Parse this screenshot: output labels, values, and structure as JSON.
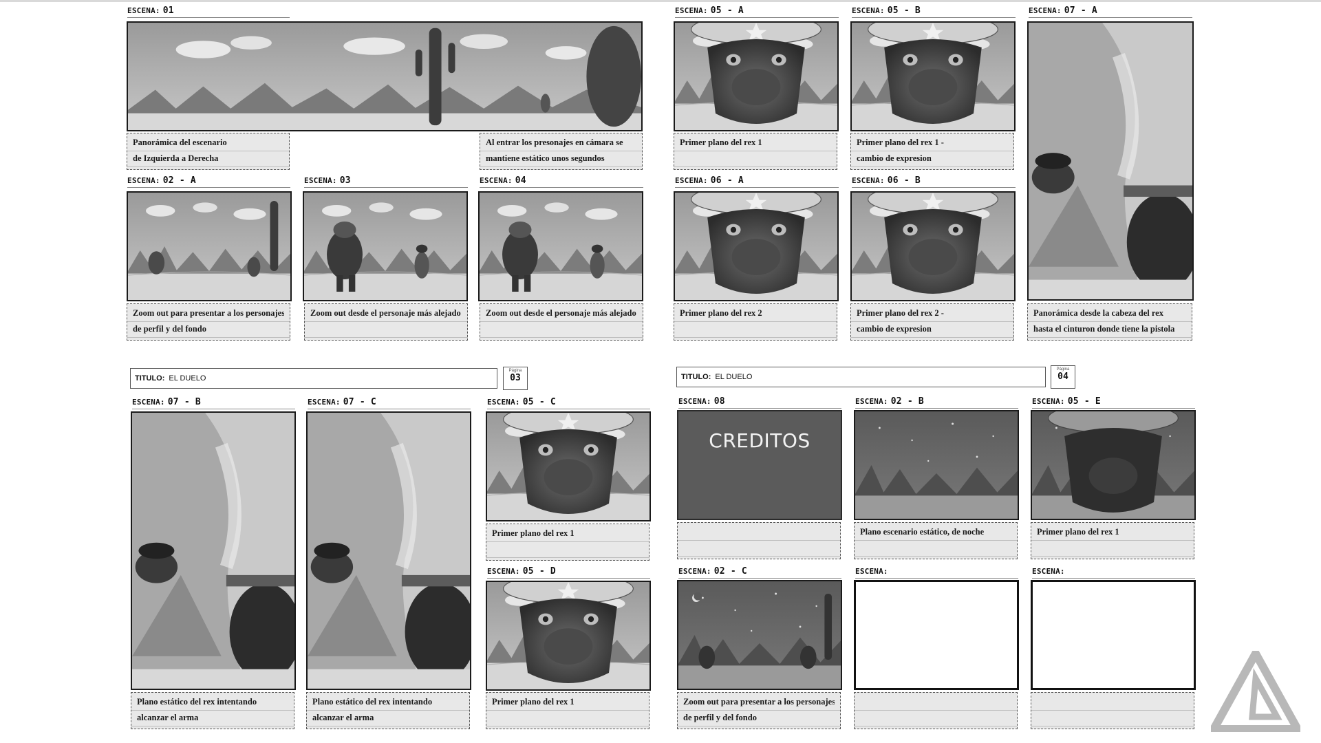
{
  "label_prefix": "ESCENA:",
  "pages": [
    {
      "title_label": "TITULO:",
      "title_value": "EL DUELO",
      "page_label": "Página",
      "page_number": "03",
      "scenes": {
        "s01": {
          "label": "01"
        },
        "s02a": {
          "label": "02 - A"
        },
        "s03": {
          "label": "03"
        },
        "s04": {
          "label": "04"
        },
        "s07b": {
          "label": "07 - B"
        },
        "s07c": {
          "label": "07 - C"
        },
        "s05c": {
          "label": "05 - C"
        },
        "s05d": {
          "label": "05 - D"
        }
      },
      "notes": {
        "s01_left": [
          "Panorámica del escenario",
          "de Izquierda a Derecha"
        ],
        "s01_right": [
          "Al entrar los presonajes en cámara se",
          "mantiene estático unos segundos"
        ],
        "s02a": [
          "Zoom out para presentar a los personajes",
          "de perfil y del fondo"
        ],
        "s03": [
          "Zoom out desde el personaje más alejado",
          ""
        ],
        "s04": [
          "Zoom out desde el personaje más alejado",
          ""
        ],
        "s07b": [
          "Plano estático del rex intentando",
          "alcanzar el arma"
        ],
        "s07c": [
          "Plano estático del rex intentando",
          "alcanzar el arma"
        ],
        "s05c": [
          "Primer plano del rex 1",
          ""
        ],
        "s05d": [
          "Primer plano del rex 1",
          ""
        ]
      }
    },
    {
      "title_label": "TITULO:",
      "title_value": "EL DUELO",
      "page_label": "Página",
      "page_number": "04",
      "scenes": {
        "s05a": {
          "label": "05 - A"
        },
        "s05b": {
          "label": "05 - B"
        },
        "s07a": {
          "label": "07 - A"
        },
        "s06a": {
          "label": "06 - A"
        },
        "s06b": {
          "label": "06 - B"
        },
        "s08": {
          "label": "08"
        },
        "s02b": {
          "label": "02 - B"
        },
        "s05e": {
          "label": "05 - E"
        },
        "s02c": {
          "label": "02 - C"
        },
        "sx1": {
          "label": ""
        },
        "sx2": {
          "label": ""
        }
      },
      "credits_text": "CREDITOS",
      "notes": {
        "s05a": [
          "Primer plano del rex 1",
          ""
        ],
        "s05b": [
          "Primer plano del rex 1 -",
          "cambio de expresion"
        ],
        "s07a": [
          "Panorámica desde la cabeza del rex",
          "hasta el cinturon donde tiene la pistola"
        ],
        "s06a": [
          "Primer plano del rex 2",
          ""
        ],
        "s06b": [
          "Primer plano del rex 2 -",
          "cambio de expresion"
        ],
        "s08": [
          "",
          ""
        ],
        "s02b": [
          "Plano escenario estático, de noche",
          ""
        ],
        "s05e": [
          "Primer plano del rex 1",
          ""
        ],
        "s02c": [
          "Zoom out para presentar a los personajes",
          "de perfil y del fondo"
        ],
        "sx1": [
          "",
          ""
        ],
        "sx2": [
          "",
          ""
        ]
      }
    }
  ],
  "frame_art": {
    "s01": "desert-panorama",
    "s02a": "two-dinos-desert",
    "s03": "dinos-facing",
    "s04": "dinos-facing",
    "s05": "rex-closeup",
    "s06": "rex2-closeup",
    "s07": "rex-belt-tall",
    "s02b": "night-desert",
    "s02c": "night-dinos"
  },
  "colors": {
    "sheet": "#ffffff",
    "frame_border": "#1a1a1a",
    "note_bg": "#e8e8e8",
    "credits_bg": "#5b5b5b"
  },
  "logo": "triangle-logo"
}
